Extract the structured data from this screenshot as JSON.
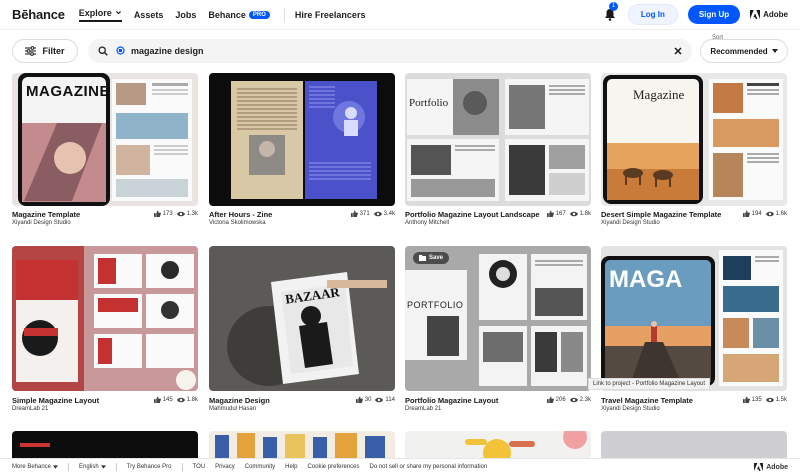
{
  "nav": {
    "logo": "Bēhance",
    "explore": "Explore",
    "assets": "Assets",
    "jobs": "Jobs",
    "behance": "Behance",
    "pro": "PRO",
    "hire": "Hire Freelancers",
    "notif_count": "1",
    "login": "Log In",
    "signup": "Sign Up",
    "adobe": "Adobe"
  },
  "search": {
    "filter_label": "Filter",
    "query": "magazine design",
    "sort_label": "Sort",
    "sort_value": "Recommended"
  },
  "cards": [
    {
      "title": "Magazine Template",
      "author": "Xiyandi Design Studio",
      "likes": "173",
      "views": "1.3k"
    },
    {
      "title": "After Hours - Zine",
      "author": "Victoria Skolimowska",
      "likes": "371",
      "views": "3.4k"
    },
    {
      "title": "Portfolio Magazine Layout Landscape",
      "author": "Anthony Mitchell",
      "likes": "167",
      "views": "1.8k"
    },
    {
      "title": "Desert Simple Magazine Template",
      "author": "Xiyandi Design Studio",
      "likes": "194",
      "views": "1.6k"
    },
    {
      "title": "Simple Magazine Layout",
      "author": "DreamLab 21",
      "likes": "145",
      "views": "1.8k"
    },
    {
      "title": "Magazine Design",
      "author": "Mahmudul Hasan",
      "likes": "30",
      "views": "114"
    },
    {
      "title": "Portfolio Magazine Layout",
      "author": "DreamLab 21",
      "likes": "206",
      "views": "2.3k"
    },
    {
      "title": "Travel Magazine Template",
      "author": "Xiyandi Design Studio",
      "likes": "135",
      "views": "1.5k"
    }
  ],
  "thumb_text": {
    "c1_title": "MAGAZINE",
    "c3_title": "Portfolio",
    "c4_title": "Magazine",
    "c6_title": "BAZAAR",
    "c7_title": "PORTFOLIO",
    "c8_title": "MAGA"
  },
  "overlay": {
    "save": "Save",
    "tooltip": "Link to project - Portfolio Magazine Layout"
  },
  "footer": {
    "more": "More Behance",
    "lang": "English",
    "try_pro": "Try Behance Pro",
    "tou": "TOU",
    "privacy": "Privacy",
    "community": "Community",
    "help": "Help",
    "cookie": "Cookie preferences",
    "donotsell": "Do not sell or share my personal information",
    "adobe": "Adobe"
  },
  "colors": {
    "accent": "#0057ff"
  }
}
